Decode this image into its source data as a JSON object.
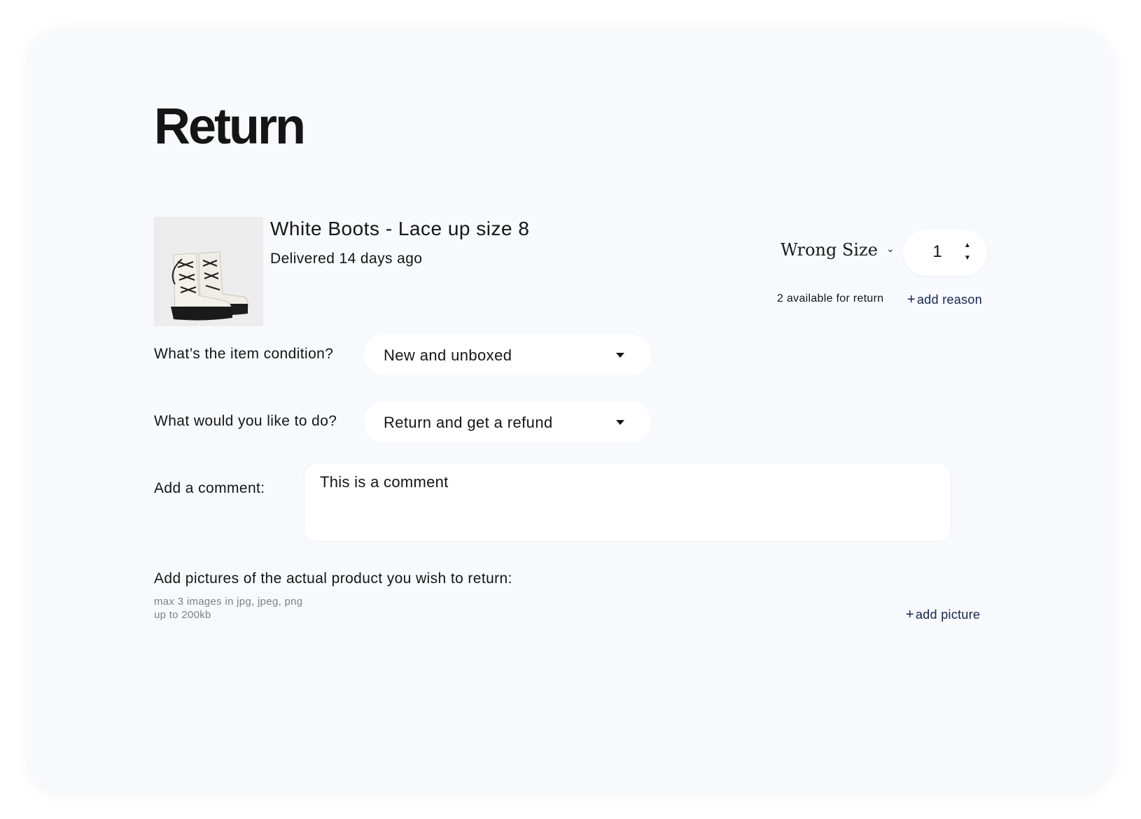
{
  "page": {
    "title": "Return"
  },
  "item": {
    "name": "White Boots - Lace up size 8",
    "delivered": "Delivered 14 days ago",
    "image_icon": "white-lace-up-boots"
  },
  "reason": {
    "selected": "Wrong Size"
  },
  "quantity": {
    "value": "1",
    "available": "2 available for return"
  },
  "add_reason": {
    "plus": "+",
    "label": "add reason"
  },
  "condition": {
    "label": "What’s the item condition?",
    "selected": "New and unboxed"
  },
  "action": {
    "label": "What would you like to do?",
    "selected": "Return and get a refund"
  },
  "comment": {
    "label": "Add a comment:",
    "value": "This is a comment"
  },
  "pictures": {
    "label": "Add pictures of the actual product you wish to return:",
    "hint_line1": "max 3 images in jpg, jpeg, png",
    "hint_line2": "up to 200kb",
    "add_plus": "+",
    "add_label": "add picture"
  },
  "colors": {
    "card_bg": "#f8f9fd",
    "link": "#16244d",
    "text": "#151515",
    "hint": "#808080"
  }
}
